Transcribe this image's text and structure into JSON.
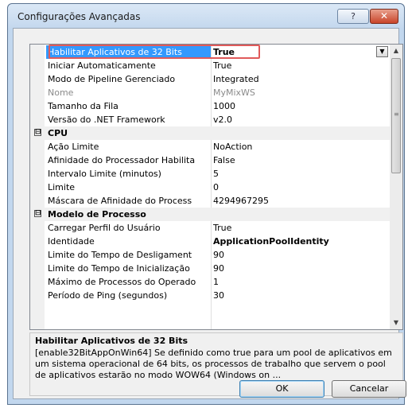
{
  "window": {
    "title": "Configurações Avançadas",
    "help_label": "?",
    "close_label": "✕"
  },
  "grid": {
    "rows": [
      {
        "kind": "prop",
        "label": "Habilitar Aplicativos de 32 Bits",
        "value": "True",
        "state": "selected"
      },
      {
        "kind": "prop",
        "label": "Iniciar Automaticamente",
        "value": "True"
      },
      {
        "kind": "prop",
        "label": "Modo de Pipeline Gerenciado",
        "value": "Integrated"
      },
      {
        "kind": "prop",
        "label": "Nome",
        "value": "MyMixWS",
        "state": "disabled"
      },
      {
        "kind": "prop",
        "label": "Tamanho da Fila",
        "value": "1000"
      },
      {
        "kind": "prop",
        "label": "Versão do .NET Framework",
        "value": "v2.0"
      },
      {
        "kind": "category",
        "label": "CPU",
        "toggle": "⊟"
      },
      {
        "kind": "prop",
        "label": "Ação Limite",
        "value": "NoAction"
      },
      {
        "kind": "prop",
        "label": "Afinidade do Processador Habilita",
        "value": "False"
      },
      {
        "kind": "prop",
        "label": "Intervalo Limite (minutos)",
        "value": "5"
      },
      {
        "kind": "prop",
        "label": "Limite",
        "value": "0"
      },
      {
        "kind": "prop",
        "label": "Máscara de Afinidade do Process",
        "value": "4294967295"
      },
      {
        "kind": "category",
        "label": "Modelo de Processo",
        "toggle": "⊟"
      },
      {
        "kind": "prop",
        "label": "Carregar Perfil do Usuário",
        "value": "True"
      },
      {
        "kind": "prop",
        "label": "Identidade",
        "value": "ApplicationPoolIdentity",
        "state": "bold"
      },
      {
        "kind": "prop",
        "label": "Limite do Tempo de Desligament",
        "value": "90"
      },
      {
        "kind": "prop",
        "label": "Limite do Tempo de Inicialização",
        "value": "90"
      },
      {
        "kind": "prop",
        "label": "Máximo de Processos do Operado",
        "value": "1"
      },
      {
        "kind": "prop",
        "label": "Período de Ping (segundos)",
        "value": "30"
      }
    ]
  },
  "description": {
    "title": "Habilitar Aplicativos de 32 Bits",
    "text": "[enable32BitAppOnWin64] Se definido como true para um pool de aplicativos em um sistema operacional de 64 bits, os processos de trabalho que servem o pool de aplicativos estarão no modo WOW64 (Windows on ..."
  },
  "buttons": {
    "ok": "OK",
    "cancel": "Cancelar"
  },
  "icons": {
    "dropdown": "▼",
    "scroll_up": "▲",
    "scroll_down": "▼",
    "grip": "≡"
  },
  "colors": {
    "selection": "#3399ff",
    "highlight_border": "#e05a5a",
    "title_bar": "#c4d8ee",
    "close_button": "#c9452a"
  }
}
